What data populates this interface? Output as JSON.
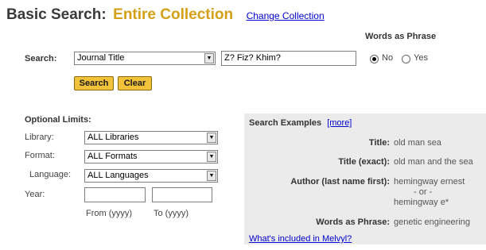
{
  "header": {
    "title_main": "Basic Search:",
    "title_collection": "Entire Collection",
    "change_collection": "Change Collection"
  },
  "search": {
    "label": "Search:",
    "field_selected": "Journal Title",
    "query_value": "Z? Fiz? Khim?",
    "phrase_heading": "Words as Phrase",
    "phrase_no": "No",
    "phrase_yes": "Yes",
    "phrase_selected": "No",
    "search_button": "Search",
    "clear_button": "Clear"
  },
  "limits": {
    "heading": "Optional Limits:",
    "library_label": "Library:",
    "library_value": "ALL Libraries",
    "format_label": "Format:",
    "format_value": "ALL Formats",
    "language_label": "Language:",
    "language_value": "ALL Languages",
    "year_label": "Year:",
    "from_label": "From (yyyy)",
    "to_label": "To (yyyy)"
  },
  "examples": {
    "heading": "Search Examples",
    "more_link": "[more]",
    "rows": [
      {
        "key": "Title:",
        "value": "old man sea"
      },
      {
        "key": "Title (exact):",
        "value": "old man and the sea"
      },
      {
        "key": "Author (last name first):",
        "value": "hemingway ernest"
      },
      {
        "key": "",
        "value": "- or -"
      },
      {
        "key": "",
        "value": "hemingway e*"
      },
      {
        "key": "Words as Phrase:",
        "value": "genetic engineering"
      }
    ],
    "included_link": "What's included in Melvyl?"
  }
}
